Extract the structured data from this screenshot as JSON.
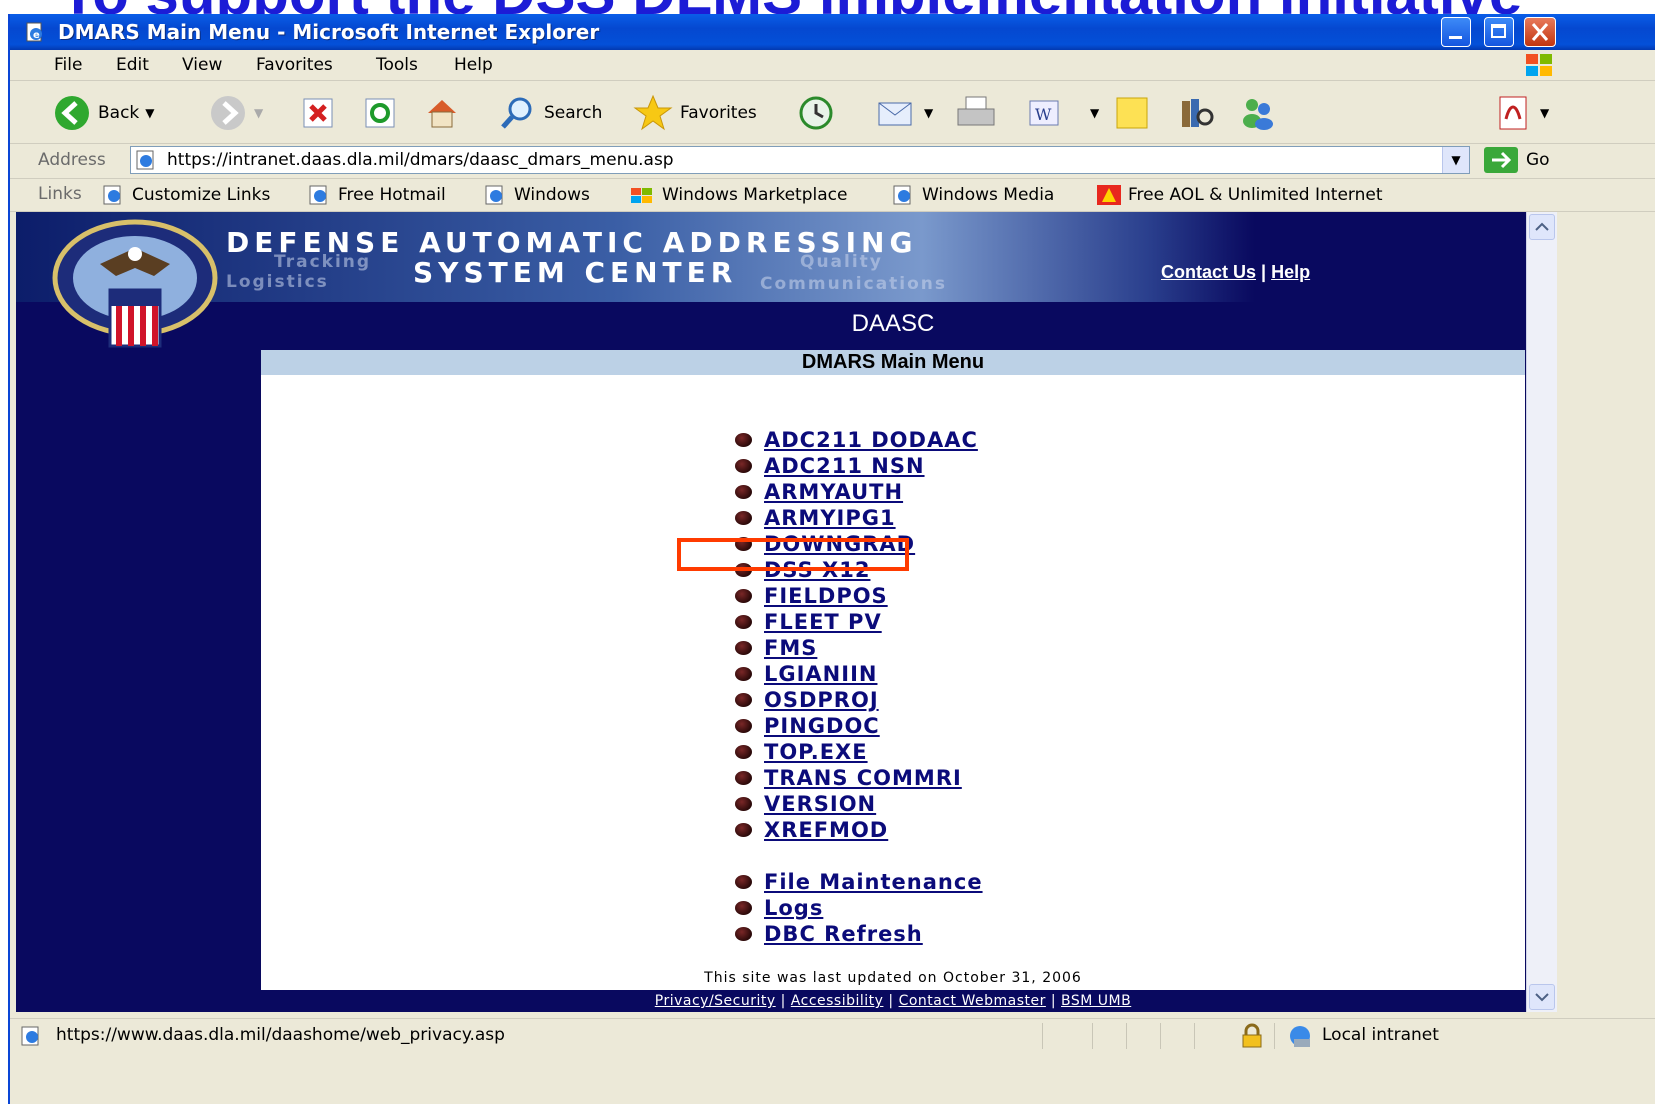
{
  "slide": {
    "title": "To support the DSS DLMS implementation initiative"
  },
  "window": {
    "title": "DMARS Main Menu - Microsoft Internet Explorer"
  },
  "menubar": {
    "items": [
      "File",
      "Edit",
      "View",
      "Favorites",
      "Tools",
      "Help"
    ]
  },
  "toolbar": {
    "back": "Back",
    "search": "Search",
    "favorites": "Favorites"
  },
  "addressbar": {
    "label": "Address",
    "url": "https://intranet.daas.dla.mil/dmars/daasc_dmars_menu.asp",
    "go": "Go"
  },
  "linksbar": {
    "label": "Links",
    "items": [
      "Customize Links",
      "Free Hotmail",
      "Windows",
      "Windows Marketplace",
      "Windows Media",
      "Free AOL & Unlimited Internet"
    ]
  },
  "page": {
    "banner_line1": "DEFENSE AUTOMATIC ADDRESSING",
    "banner_line2": "SYSTEM CENTER",
    "banner_words": [
      "Tracking",
      "Logistics",
      "Quality",
      "Communications"
    ],
    "contact_us": "Contact Us",
    "separator": "|",
    "help": "Help",
    "site_name": "DAASC",
    "menu_title": "DMARS Main Menu",
    "menu_items": [
      "ADC211 DODAAC",
      "ADC211 NSN",
      "ARMYAUTH",
      "ARMYIPG1",
      "DOWNGRAD",
      "DSS X12",
      "FIELDPOS",
      "FLEET PV",
      "FMS",
      "LGIANIIN",
      "OSDPROJ",
      "PINGDOC",
      "TOP.EXE",
      "TRANS COMMRI",
      "VERSION",
      "XREFMOD"
    ],
    "admin_items": [
      "File Maintenance",
      "Logs",
      "DBC Refresh"
    ],
    "last_updated": "This site was last updated on October 31, 2006",
    "footer_links": [
      "Privacy/Security",
      "Accessibility",
      "Contact Webmaster",
      "BSM UMB"
    ],
    "highlighted_item": "DSS X12",
    "highlight_color": "#ff3b00"
  },
  "statusbar": {
    "url": "https://www.daas.dla.mil/daashome/web_privacy.asp",
    "zone": "Local intranet"
  }
}
